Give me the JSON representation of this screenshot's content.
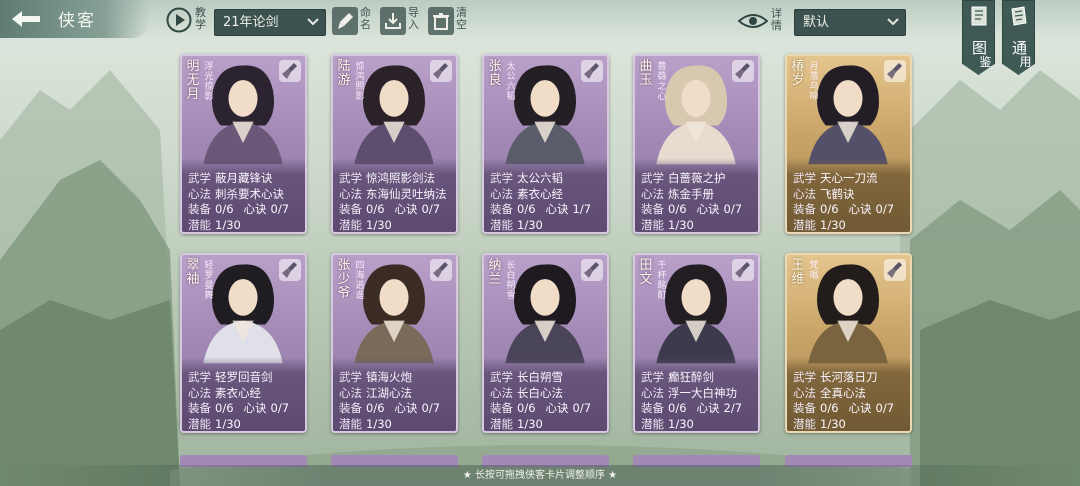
{
  "header": {
    "title": "侠客",
    "tutorial_label_1": "教",
    "tutorial_label_2": "学",
    "season_select": "21年论剑",
    "rename_1": "命",
    "rename_2": "名",
    "import_1": "导",
    "import_2": "入",
    "clear_1": "清",
    "clear_2": "空",
    "details_1": "详",
    "details_2": "情",
    "sort_select": "默认",
    "codex_1": "图",
    "codex_2": "鉴",
    "common_1": "通",
    "common_2": "用"
  },
  "labels": {
    "martial": "武学",
    "mind": "心法",
    "equip": "装备",
    "secret": "心诀",
    "potential": "潜能"
  },
  "cards": [
    {
      "name": "明无月",
      "title": "浮光掠影",
      "martial": "蔽月藏锋诀",
      "mind": "刺杀要术心诀",
      "equip": "0/6",
      "secret": "0/7",
      "potential": "1/30",
      "rarity": "purple"
    },
    {
      "name": "陆游",
      "title": "惊鸿照影",
      "martial": "惊鸿照影剑法",
      "mind": "东海仙灵吐纳法",
      "equip": "0/6",
      "secret": "0/7",
      "potential": "1/30",
      "rarity": "purple"
    },
    {
      "name": "张良",
      "title": "太公六韬",
      "martial": "太公六韬",
      "mind": "素衣心经",
      "equip": "0/6",
      "secret": "1/7",
      "potential": "1/30",
      "rarity": "purple"
    },
    {
      "name": "曲玉",
      "title": "蔷薇之心",
      "martial": "白蔷薇之护",
      "mind": "炼金手册",
      "equip": "0/6",
      "secret": "0/7",
      "potential": "1/30",
      "rarity": "purple"
    },
    {
      "name": "椿岁",
      "title": "月落乌啼",
      "martial": "天心一刀流",
      "mind": "飞鹤诀",
      "equip": "0/6",
      "secret": "0/7",
      "potential": "1/30",
      "rarity": "gold"
    },
    {
      "name": "翠袖",
      "title": "轻罗曼舞",
      "martial": "轻罗回音剑",
      "mind": "素衣心经",
      "equip": "0/6",
      "secret": "0/7",
      "potential": "1/30",
      "rarity": "purple"
    },
    {
      "name": "张少爷",
      "title": "四海逍遥",
      "martial": "镇海火炮",
      "mind": "江湖心法",
      "equip": "0/6",
      "secret": "0/7",
      "potential": "1/30",
      "rarity": "purple"
    },
    {
      "name": "纳兰",
      "title": "长白朔雪",
      "martial": "长白朔雪",
      "mind": "长白心法",
      "equip": "0/6",
      "secret": "0/7",
      "potential": "1/30",
      "rarity": "purple"
    },
    {
      "name": "田文",
      "title": "千杯酩酊",
      "martial": "癫狂醉剑",
      "mind": "浮一大白神功",
      "equip": "0/6",
      "secret": "2/7",
      "potential": "1/30",
      "rarity": "purple"
    },
    {
      "name": "王维",
      "title": "梵唱",
      "martial": "长河落日刀",
      "mind": "全真心法",
      "equip": "0/6",
      "secret": "0/7",
      "potential": "1/30",
      "rarity": "gold"
    }
  ],
  "footer_hint": "★ 长按可拖拽侠客卡片调整顺序 ★",
  "colors": {
    "purple_card": "#a38ab6",
    "gold_card": "#c9a468",
    "header_dark": "#3b5250"
  },
  "icons": [
    "back-arrow-icon",
    "play-icon",
    "brush-icon",
    "import-icon",
    "trash-icon",
    "eye-icon",
    "book-icon",
    "scroll-icon",
    "broom-icon",
    "chevron-down-icon"
  ]
}
